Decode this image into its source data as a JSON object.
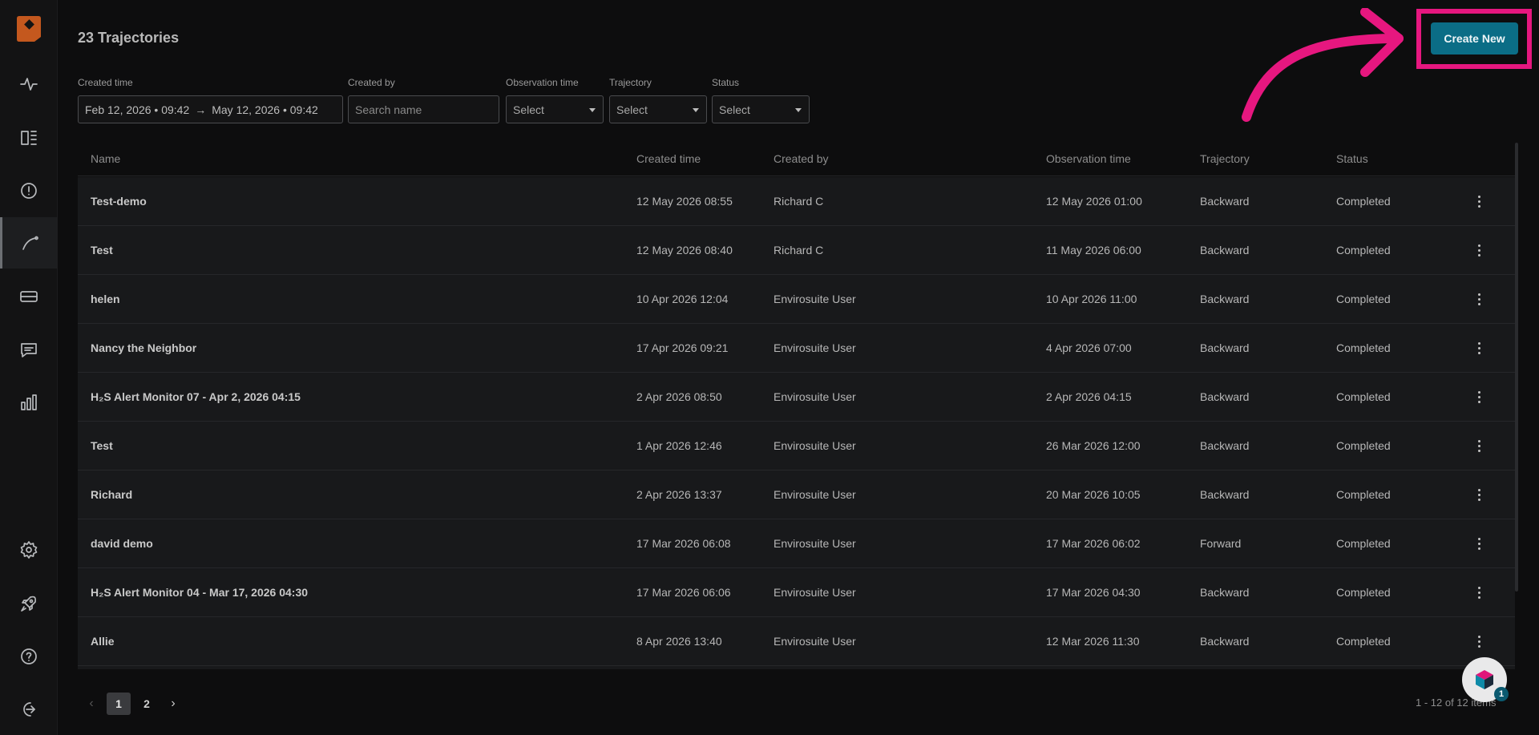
{
  "header": {
    "title": "23 Trajectories",
    "create_button": "Create New"
  },
  "filters": {
    "created_time": {
      "label": "Created time",
      "start": "Feb 12, 2026 • 09:42",
      "arrow": "→",
      "end": "May 12, 2026 • 09:42"
    },
    "created_by": {
      "label": "Created by",
      "placeholder": "Search name"
    },
    "observation_time": {
      "label": "Observation time",
      "value": "Select"
    },
    "trajectory": {
      "label": "Trajectory",
      "value": "Select"
    },
    "status": {
      "label": "Status",
      "value": "Select"
    }
  },
  "table": {
    "columns": [
      "Name",
      "Created time",
      "Created by",
      "Observation time",
      "Trajectory",
      "Status"
    ],
    "rows": [
      {
        "name": "Test-demo",
        "created": "12 May 2026 08:55",
        "by": "Richard C",
        "observation": "12 May 2026 01:00",
        "trajectory": "Backward",
        "status": "Completed"
      },
      {
        "name": "Test",
        "created": "12 May 2026 08:40",
        "by": "Richard C",
        "observation": "11 May 2026 06:00",
        "trajectory": "Backward",
        "status": "Completed"
      },
      {
        "name": "helen",
        "created": "10 Apr 2026 12:04",
        "by": "Envirosuite User",
        "observation": "10 Apr 2026 11:00",
        "trajectory": "Backward",
        "status": "Completed"
      },
      {
        "name": "Nancy the Neighbor",
        "created": "17 Apr 2026 09:21",
        "by": "Envirosuite User",
        "observation": "4 Apr 2026 07:00",
        "trajectory": "Backward",
        "status": "Completed"
      },
      {
        "name": "H₂S Alert Monitor 07 - Apr 2, 2026 04:15",
        "created": "2 Apr 2026 08:50",
        "by": "Envirosuite User",
        "observation": "2 Apr 2026 04:15",
        "trajectory": "Backward",
        "status": "Completed"
      },
      {
        "name": "Test",
        "created": "1 Apr 2026 12:46",
        "by": "Envirosuite User",
        "observation": "26 Mar 2026 12:00",
        "trajectory": "Backward",
        "status": "Completed"
      },
      {
        "name": "Richard",
        "created": "2 Apr 2026 13:37",
        "by": "Envirosuite User",
        "observation": "20 Mar 2026 10:05",
        "trajectory": "Backward",
        "status": "Completed"
      },
      {
        "name": "david demo",
        "created": "17 Mar 2026 06:08",
        "by": "Envirosuite User",
        "observation": "17 Mar 2026 06:02",
        "trajectory": "Forward",
        "status": "Completed"
      },
      {
        "name": "H₂S Alert Monitor 04 - Mar 17, 2026 04:30",
        "created": "17 Mar 2026 06:06",
        "by": "Envirosuite User",
        "observation": "17 Mar 2026 04:30",
        "trajectory": "Backward",
        "status": "Completed"
      },
      {
        "name": "Allie",
        "created": "8 Apr 2026 13:40",
        "by": "Envirosuite User",
        "observation": "12 Mar 2026 11:30",
        "trajectory": "Backward",
        "status": "Completed"
      },
      {
        "name": "",
        "created": "",
        "by": "",
        "observation": "",
        "trajectory": "",
        "status": ""
      }
    ]
  },
  "pagination": {
    "pages": [
      "1",
      "2"
    ],
    "current": "1",
    "summary": "1 - 12 of 12 items"
  },
  "help_widget": {
    "badge": "1"
  },
  "sidebar": {
    "icons": [
      "logo-icon",
      "activity-icon",
      "dashboard-icon",
      "alert-icon",
      "trajectory-icon",
      "ticket-icon",
      "message-icon",
      "chart-icon",
      "settings-icon",
      "rocket-icon",
      "help-icon",
      "logout-icon"
    ],
    "active": "trajectory-icon"
  },
  "colors": {
    "accent": "#0b6d86",
    "highlight": "#e6177f",
    "logo": "#c4581e"
  }
}
